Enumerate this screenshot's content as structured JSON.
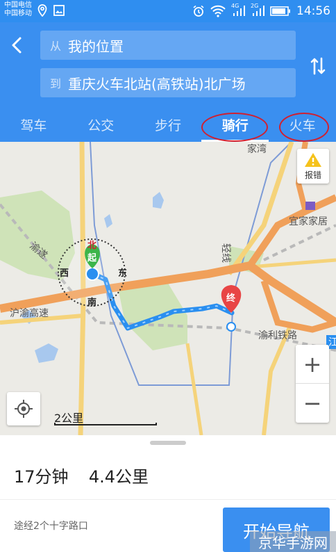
{
  "status_bar": {
    "carrier_1": "中国电信",
    "carrier_2": "中国移动",
    "net_1": "4G",
    "net_2": "2G",
    "time": "14:56"
  },
  "header": {
    "from_prefix": "从",
    "from_value": "我的位置",
    "to_prefix": "到",
    "to_value": "重庆火车北站(高铁站)北广场",
    "tabs": [
      {
        "label": "驾车"
      },
      {
        "label": "公交"
      },
      {
        "label": "步行"
      },
      {
        "label": "骑行"
      },
      {
        "label": "火车"
      }
    ],
    "active_tab": "骑行",
    "accent_color": "#3a8ff0",
    "highlight_color": "#d02030"
  },
  "map": {
    "report_label": "报错",
    "labels": {
      "place_1": "宜家家居",
      "road_1": "沪渝高速",
      "road_2": "渝利铁路",
      "road_3": "渝遂",
      "road_4": "轻线",
      "place_2": "家湾",
      "road_5": "江"
    },
    "compass": {
      "north": "北",
      "south": "南",
      "east": "东",
      "west": "西"
    },
    "start_marker": "起",
    "end_marker": "终",
    "scale_text": "2公里",
    "zoom_in": "+",
    "zoom_out": "−"
  },
  "panel": {
    "duration": "17分钟",
    "distance": "4.4公里",
    "via": "途经2个十字路口",
    "start_nav": "开始导航",
    "watermark": "京华手游网"
  }
}
